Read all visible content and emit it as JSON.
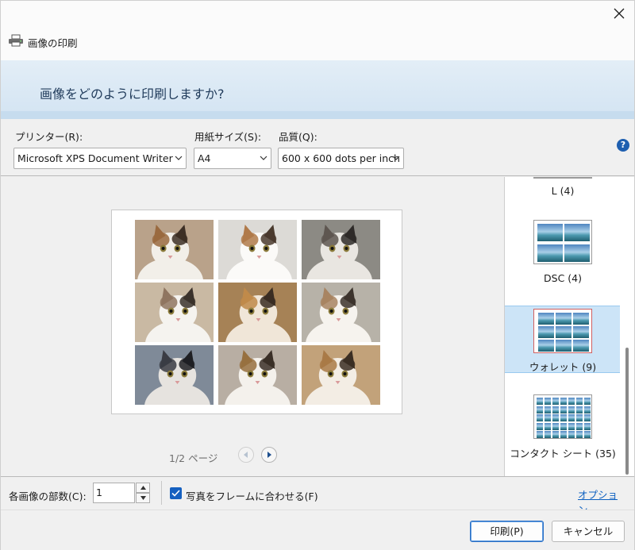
{
  "window": {
    "title": "画像の印刷"
  },
  "header": {
    "question": "画像をどのように印刷しますか?"
  },
  "settings": {
    "printer_label": "プリンター(R):",
    "printer_value": "Microsoft XPS Document Writer",
    "paper_label": "用紙サイズ(S):",
    "paper_value": "A4",
    "quality_label": "品質(Q):",
    "quality_value": "600 x 600 dots per inch",
    "help_glyph": "?"
  },
  "preview": {
    "page_indicator": "1/2 ページ",
    "photo_count": 9
  },
  "layouts": {
    "items": [
      {
        "label": "L (4)",
        "selected": false
      },
      {
        "label": "DSC (4)",
        "selected": false
      },
      {
        "label": "ウォレット (9)",
        "selected": true
      },
      {
        "label": "コンタクト シート (35)",
        "selected": false
      }
    ]
  },
  "options": {
    "copies_label": "各画像の部数(C):",
    "copies_value": "1",
    "fit_label": "写真をフレームに合わせる(F)",
    "fit_checked": true,
    "options_link": "オプション..."
  },
  "buttons": {
    "print": "印刷(P)",
    "cancel": "キャンセル"
  },
  "colors": {
    "accent": "#1560c0",
    "selection": "#cce4f7",
    "banner": "#dbe9f5"
  }
}
